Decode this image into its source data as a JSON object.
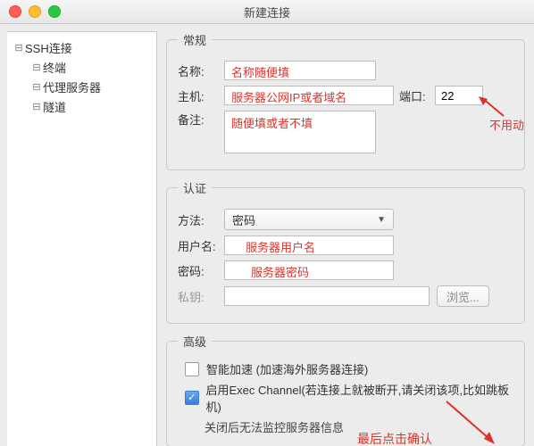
{
  "window": {
    "title": "新建连接"
  },
  "sidebar": {
    "root": "SSH连接",
    "items": [
      "终端",
      "代理服务器",
      "隧道"
    ]
  },
  "general": {
    "legend": "常规",
    "name_label": "名称:",
    "name_anno": "名称随便填",
    "host_label": "主机:",
    "host_anno": "服务器公网IP或者域名",
    "port_label": "端口:",
    "port_value": "22",
    "port_anno": "不用动",
    "remark_label": "备注:",
    "remark_anno": "随便填或者不填"
  },
  "auth": {
    "legend": "认证",
    "method_label": "方法:",
    "method_value": "密码",
    "user_label": "用户名:",
    "user_anno": "服务器用户名",
    "pwd_label": "密码:",
    "pwd_anno": "服务器密码",
    "key_label": "私钥:",
    "browse_label": "浏览..."
  },
  "advanced": {
    "legend": "高级",
    "accel_label": "智能加速 (加速海外服务器连接)",
    "exec_label": "启用Exec Channel(若连接上就被断开,请关闭该项,比如跳板机)",
    "exec_sub": "关闭后无法监控服务器信息"
  },
  "final_anno": "最后点击确认"
}
